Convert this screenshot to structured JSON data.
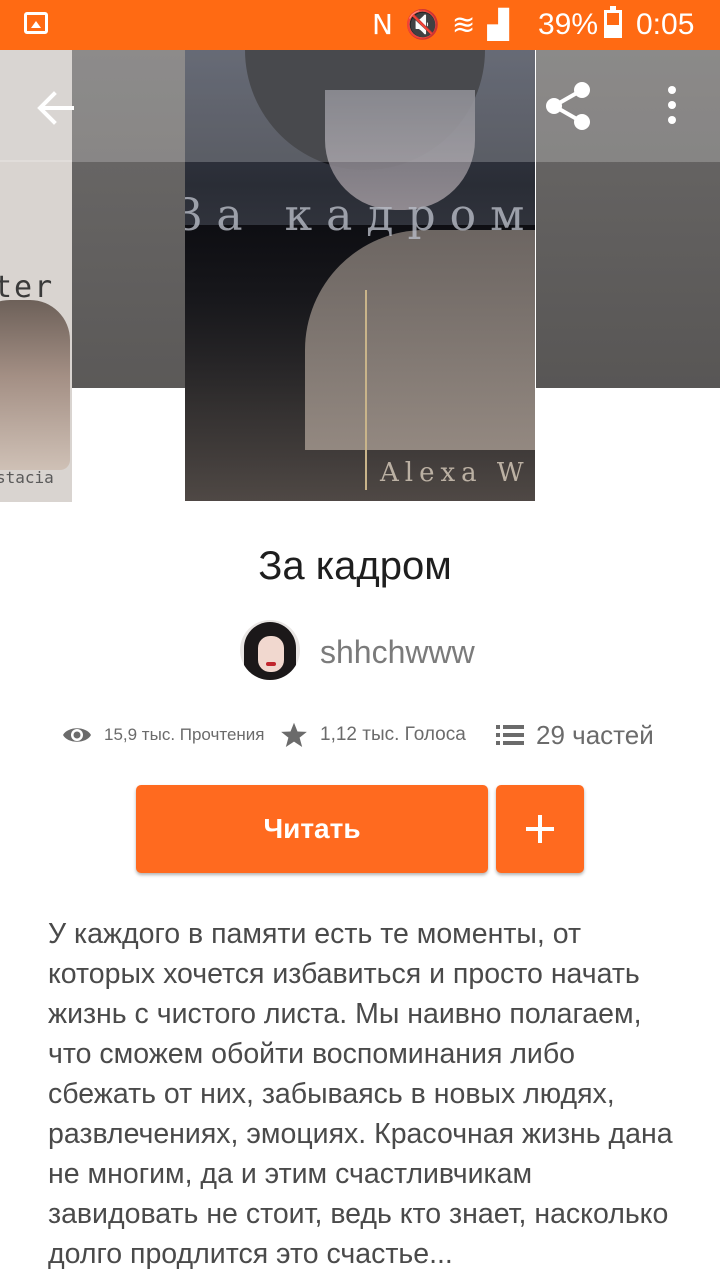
{
  "status_bar": {
    "battery_percent": "39%",
    "time": "0:05",
    "icons": [
      "gallery-notification-icon",
      "nfc-icon",
      "mute-icon",
      "wifi-icon",
      "signal-icon",
      "battery-icon"
    ]
  },
  "carousel": {
    "left_cover_text": "ter",
    "left_cover_subtext": "stacia",
    "cover_title": "За кадром",
    "cover_author": "Alexa W"
  },
  "story": {
    "title": "За кадром",
    "author": "shhchwww",
    "reads": "15,9 тыс. Прочтения",
    "votes": "1,12 тыс. Голоса",
    "parts": "29 частей",
    "read_button": "Читать",
    "add_button": "+",
    "description": "У каждого в памяти есть те моменты, от которых хочется избавиться и просто начать жизнь с чистого листа. Мы наивно полагаем, что сможем обойти воспоминания либо сбежать от них, забываясь в новых людях, развлечениях, эмоциях. Красочная жизнь дана не многим, да и этим счастливчикам завидовать не стоит, ведь кто знает, насколько долго продлится это счастье..."
  },
  "colors": {
    "accent": "#ff6a13",
    "button": "#ff6a1f",
    "text_primary": "#1e1e1e",
    "text_secondary": "#6b6b6b"
  }
}
